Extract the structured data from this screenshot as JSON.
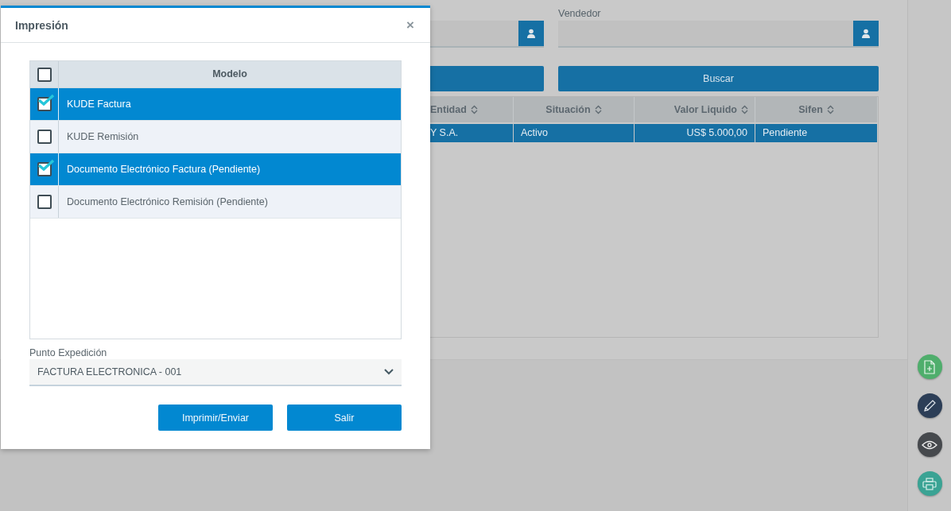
{
  "background": {
    "vendedor_label": "Vendedor",
    "search_button": "Buscar",
    "table": {
      "columns": [
        "Entidad",
        "Situación",
        "Valor Liquido",
        "Sifen"
      ],
      "rows": [
        {
          "selected": true,
          "cells": [
            "Y S.A.",
            "Activo",
            "US$ 5.000,00",
            "Pendiente"
          ]
        }
      ]
    }
  },
  "dialog": {
    "title": "Impresión",
    "close": "×",
    "header": {
      "checked": false,
      "label": "Modelo"
    },
    "rows": [
      {
        "label": "KUDE Factura",
        "checked": true,
        "selected": true
      },
      {
        "label": "KUDE Remisión",
        "checked": false,
        "selected": false
      },
      {
        "label": "Documento Electrónico Factura (Pendiente)",
        "checked": true,
        "selected": true
      },
      {
        "label": "Documento Electrónico Remisión (Pendiente)",
        "checked": false,
        "selected": false
      }
    ],
    "punto_label": "Punto Expedición",
    "punto_value": "FACTURA ELECTRONICA - 001",
    "buttons": [
      "Imprimir/Enviar",
      "Salir"
    ]
  }
}
